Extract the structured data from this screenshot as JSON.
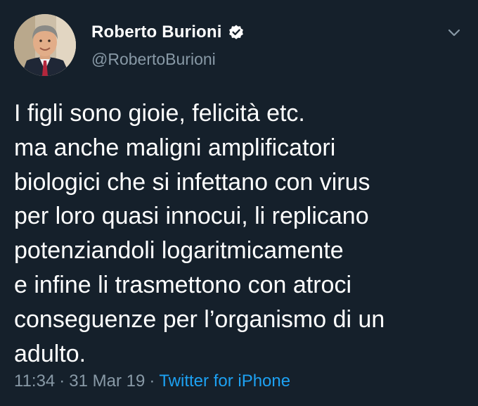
{
  "author": {
    "display_name": "Roberto Burioni",
    "handle": "@RobertoBurioni",
    "verified_icon": "verified-badge-icon",
    "avatar_icon": "user-avatar"
  },
  "menu": {
    "icon": "chevron-down-icon"
  },
  "tweet": {
    "lines": [
      "I figli sono gioie, felicità etc.",
      "ma anche maligni amplificatori",
      "biologici che si infettano con virus",
      "per loro quasi innocui, li replicano",
      "potenziandoli logaritmicamente",
      "e infine li trasmettono con atroci",
      "conseguenze per l’organismo di un",
      "adulto."
    ]
  },
  "meta": {
    "time": "11:34",
    "separator": "·",
    "date": "31 Mar 19",
    "source": "Twitter for iPhone"
  },
  "colors": {
    "background": "#15202b",
    "secondary_text": "#8899a6",
    "link": "#1da1f2"
  }
}
